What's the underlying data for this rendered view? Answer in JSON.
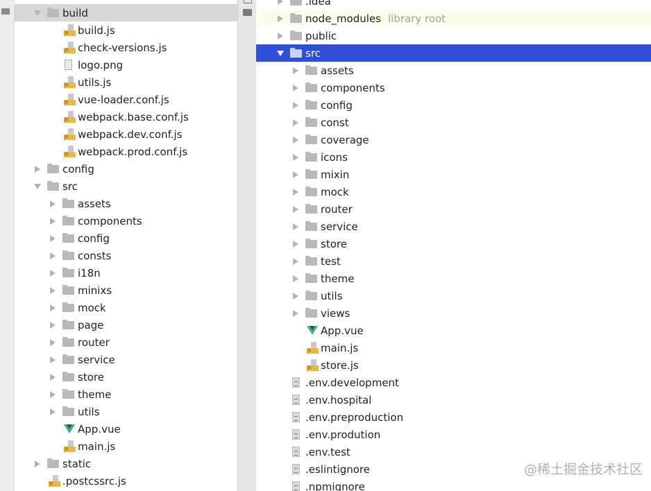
{
  "left_tree": [
    {
      "name": "build",
      "type": "folder",
      "level": 0,
      "expanded": true,
      "selected": "gray"
    },
    {
      "name": "build.js",
      "type": "js",
      "level": 1
    },
    {
      "name": "check-versions.js",
      "type": "js",
      "level": 1
    },
    {
      "name": "logo.png",
      "type": "png",
      "level": 1
    },
    {
      "name": "utils.js",
      "type": "js",
      "level": 1
    },
    {
      "name": "vue-loader.conf.js",
      "type": "js",
      "level": 1
    },
    {
      "name": "webpack.base.conf.js",
      "type": "js",
      "level": 1
    },
    {
      "name": "webpack.dev.conf.js",
      "type": "js",
      "level": 1
    },
    {
      "name": "webpack.prod.conf.js",
      "type": "js",
      "level": 1
    },
    {
      "name": "config",
      "type": "folder",
      "level": 0,
      "expanded": false
    },
    {
      "name": "src",
      "type": "folder",
      "level": 0,
      "expanded": true
    },
    {
      "name": "assets",
      "type": "folder",
      "level": 1,
      "expanded": false
    },
    {
      "name": "components",
      "type": "folder",
      "level": 1,
      "expanded": false
    },
    {
      "name": "config",
      "type": "folder",
      "level": 1,
      "expanded": false
    },
    {
      "name": "consts",
      "type": "folder",
      "level": 1,
      "expanded": false
    },
    {
      "name": "i18n",
      "type": "folder",
      "level": 1,
      "expanded": false
    },
    {
      "name": "minixs",
      "type": "folder",
      "level": 1,
      "expanded": false
    },
    {
      "name": "mock",
      "type": "folder",
      "level": 1,
      "expanded": false
    },
    {
      "name": "page",
      "type": "folder",
      "level": 1,
      "expanded": false
    },
    {
      "name": "router",
      "type": "folder",
      "level": 1,
      "expanded": false
    },
    {
      "name": "service",
      "type": "folder",
      "level": 1,
      "expanded": false
    },
    {
      "name": "store",
      "type": "folder",
      "level": 1,
      "expanded": false
    },
    {
      "name": "theme",
      "type": "folder",
      "level": 1,
      "expanded": false
    },
    {
      "name": "utils",
      "type": "folder",
      "level": 1,
      "expanded": false
    },
    {
      "name": "App.vue",
      "type": "vue",
      "level": 1
    },
    {
      "name": "main.js",
      "type": "js",
      "level": 1
    },
    {
      "name": "static",
      "type": "folder",
      "level": 0,
      "expanded": false
    },
    {
      "name": ".postcssrc.js",
      "type": "js",
      "level": 0
    }
  ],
  "right_tree": [
    {
      "name": ".idea",
      "type": "folder",
      "level": 0,
      "expanded": false
    },
    {
      "name": "node_modules",
      "type": "folder",
      "level": 0,
      "expanded": false,
      "note": "library root",
      "highlight": "lib"
    },
    {
      "name": "public",
      "type": "folder",
      "level": 0,
      "expanded": false
    },
    {
      "name": "src",
      "type": "folder",
      "level": 0,
      "expanded": true,
      "selected": "blue"
    },
    {
      "name": "assets",
      "type": "folder",
      "level": 1,
      "expanded": false
    },
    {
      "name": "components",
      "type": "folder",
      "level": 1,
      "expanded": false
    },
    {
      "name": "config",
      "type": "folder",
      "level": 1,
      "expanded": false
    },
    {
      "name": "const",
      "type": "folder",
      "level": 1,
      "expanded": false
    },
    {
      "name": "coverage",
      "type": "folder",
      "level": 1,
      "expanded": false
    },
    {
      "name": "icons",
      "type": "folder",
      "level": 1,
      "expanded": false
    },
    {
      "name": "mixin",
      "type": "folder",
      "level": 1,
      "expanded": false
    },
    {
      "name": "mock",
      "type": "folder",
      "level": 1,
      "expanded": false
    },
    {
      "name": "router",
      "type": "folder",
      "level": 1,
      "expanded": false
    },
    {
      "name": "service",
      "type": "folder",
      "level": 1,
      "expanded": false
    },
    {
      "name": "store",
      "type": "folder",
      "level": 1,
      "expanded": false
    },
    {
      "name": "test",
      "type": "folder",
      "level": 1,
      "expanded": false
    },
    {
      "name": "theme",
      "type": "folder",
      "level": 1,
      "expanded": false
    },
    {
      "name": "utils",
      "type": "folder",
      "level": 1,
      "expanded": false
    },
    {
      "name": "views",
      "type": "folder",
      "level": 1,
      "expanded": false
    },
    {
      "name": "App.vue",
      "type": "vue",
      "level": 1
    },
    {
      "name": "main.js",
      "type": "js",
      "level": 1
    },
    {
      "name": "store.js",
      "type": "js",
      "level": 1
    },
    {
      "name": ".env.development",
      "type": "file",
      "level": 0
    },
    {
      "name": ".env.hospital",
      "type": "file",
      "level": 0
    },
    {
      "name": ".env.preproduction",
      "type": "file",
      "level": 0
    },
    {
      "name": ".env.prodution",
      "type": "file",
      "level": 0
    },
    {
      "name": ".env.test",
      "type": "file",
      "level": 0
    },
    {
      "name": ".eslintignore",
      "type": "file",
      "level": 0
    },
    {
      "name": ".npmignore",
      "type": "file",
      "level": 0
    }
  ],
  "icons": {
    "folder": "folder-icon",
    "js": "js-file-icon",
    "vue": "vue-file-icon",
    "png": "image-file-icon",
    "file": "text-file-icon"
  },
  "colors": {
    "selection_blue": "#2f4fd9",
    "selection_gray": "#d7d7d7",
    "library_root_bg": "#fcfcee",
    "js_badge": "#e8b84a",
    "vue_green": "#3fb27f"
  },
  "watermark": "@稀土掘金技术社区"
}
